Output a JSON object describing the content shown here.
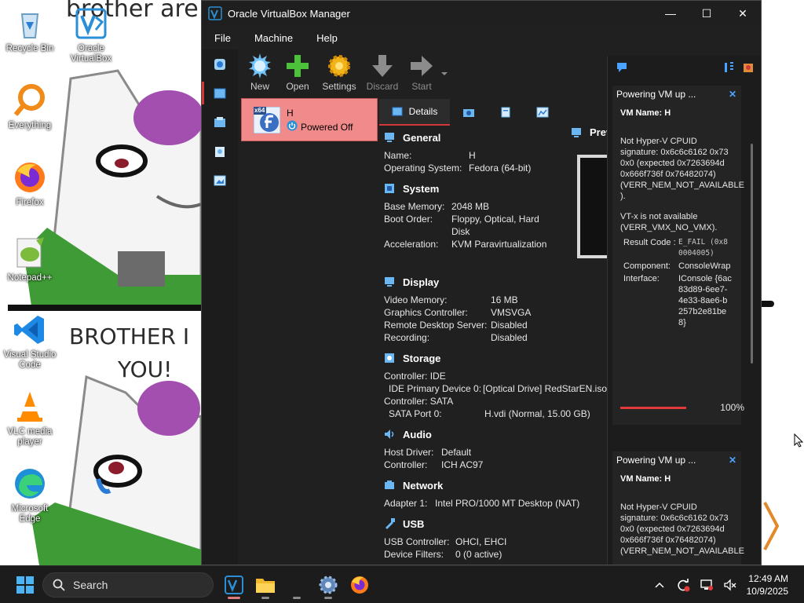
{
  "desktop": {
    "wallpaper_text_top": "brother are",
    "wallpaper_text_mid": "BROTHER I",
    "wallpaper_text_mid2": "YOU!",
    "icons": [
      {
        "label": "Recycle Bin"
      },
      {
        "label": "Oracle VirtualBox"
      },
      {
        "label": "Everything"
      },
      {
        "label": "Firefox"
      },
      {
        "label": "Notepad++"
      },
      {
        "label": "Visual Studio Code"
      },
      {
        "label": "VLC media player"
      },
      {
        "label": "Microsoft Edge"
      }
    ]
  },
  "window": {
    "title": "Oracle VirtualBox Manager",
    "controls": {
      "minimize": "—",
      "maximize": "☐",
      "close": "✕"
    }
  },
  "menu": [
    "File",
    "Machine",
    "Help"
  ],
  "toolbar": [
    {
      "label": "New",
      "icon": "new-vm-icon",
      "enabled": true
    },
    {
      "label": "Open",
      "icon": "add-vm-icon",
      "enabled": true
    },
    {
      "label": "Settings",
      "icon": "settings-gear-icon",
      "enabled": true
    },
    {
      "label": "Discard",
      "icon": "discard-arrow-icon",
      "enabled": false
    },
    {
      "label": "Start",
      "icon": "start-arrow-icon",
      "enabled": false
    }
  ],
  "vm": {
    "name": "H",
    "os_badge": "x64",
    "state": "Powered Off"
  },
  "tabs": {
    "details": "Details"
  },
  "details": {
    "general": {
      "title": "General",
      "name_k": "Name:",
      "name_v": "H",
      "os_k": "Operating System:",
      "os_v": "Fedora (64-bit)"
    },
    "system": {
      "title": "System",
      "mem_k": "Base Memory:",
      "mem_v": "2048 MB",
      "boot_k": "Boot Order:",
      "boot_v": "Floppy, Optical, Hard Disk",
      "accel_k": "Acceleration:",
      "accel_v": "KVM Paravirtualization"
    },
    "display": {
      "title": "Display",
      "vmem_k": "Video Memory:",
      "vmem_v": "16 MB",
      "gc_k": "Graphics Controller:",
      "gc_v": "VMSVGA",
      "rds_k": "Remote Desktop Server:",
      "rds_v": "Disabled",
      "rec_k": "Recording:",
      "rec_v": "Disabled"
    },
    "storage": {
      "title": "Storage",
      "ctrl1": "Controller: IDE",
      "ide_k": "IDE Primary Device 0:",
      "ide_v": "[Optical Drive] RedStarEN.iso",
      "ctrl2": "Controller: SATA",
      "sata_k": "SATA Port 0:",
      "sata_v": "H.vdi (Normal, 15.00 GB)"
    },
    "audio": {
      "title": "Audio",
      "host_k": "Host Driver:",
      "host_v": "Default",
      "ctrl_k": "Controller:",
      "ctrl_v": "ICH AC97"
    },
    "network": {
      "title": "Network",
      "a1_k": "Adapter 1:",
      "a1_v": "Intel PRO/1000 MT Desktop (NAT)"
    },
    "usb": {
      "title": "USB",
      "uc_k": "USB Controller:",
      "uc_v": "OHCI, EHCI",
      "df_k": "Device Filters:",
      "df_v": "0 (0 active)"
    }
  },
  "preview": {
    "title": "Prev"
  },
  "notifications": [
    {
      "title": "Powering VM up ...",
      "vm_name": "VM Name: H",
      "message": "Not Hyper-V CPUID signature: 0x6c6c6162 0x73 0x0 (expected 0x7263694d 0x666f736f 0x76482074) (VERR_NEM_NOT_AVAILABLE ).",
      "message2": "VT-x is not available (VERR_VMX_NO_VMX).",
      "result_k": "Result Code :",
      "result_v": "E_FAIL (0x80004005)",
      "component_k": "Component:",
      "component_v": "ConsoleWrap",
      "interface_k": "Interface:",
      "interface_v": "IConsole {6ac83d89-6ee7-4e33-8ae6-b257b2e81be8}",
      "progress": 1.0,
      "progress_label": "100%"
    },
    {
      "title": "Powering VM up ...",
      "vm_name": "VM Name: H",
      "message": "Not Hyper-V CPUID signature: 0x6c6c6162 0x73 0x0 (expected 0x7263694d 0x666f736f 0x76482074) (VERR_NEM_NOT_AVAILABLE"
    }
  ],
  "taskbar": {
    "search_placeholder": "Search",
    "time": "12:49 AM",
    "date": "10/9/2025"
  },
  "colors": {
    "selected_vm": "#f18b8b",
    "accent_red": "#d23838",
    "progress": "#e03a3a",
    "dark_bg": "#202020"
  }
}
